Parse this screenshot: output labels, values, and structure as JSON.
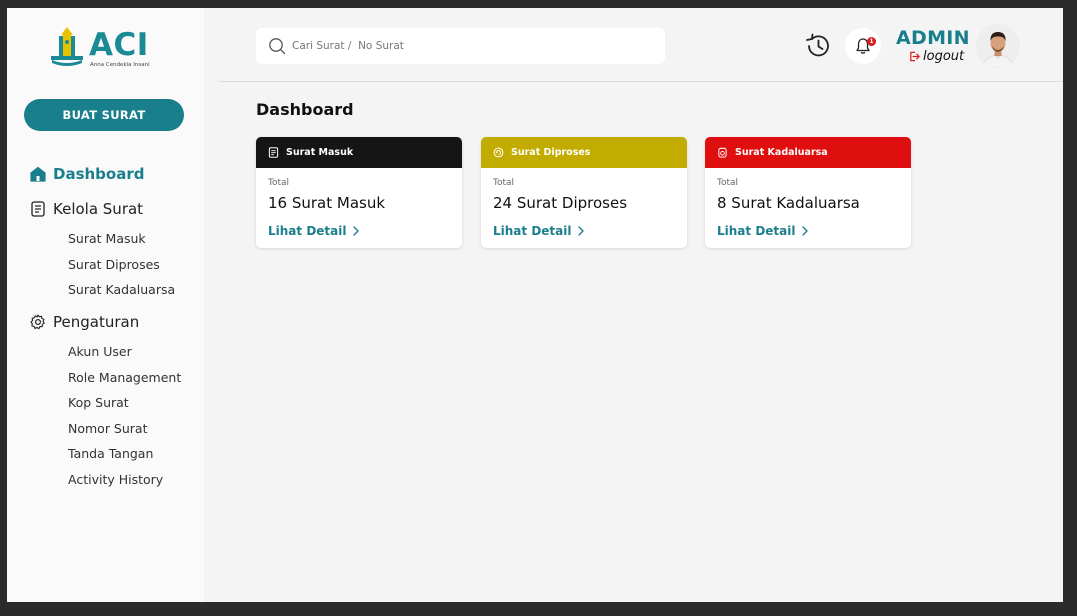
{
  "brand": {
    "name": "ACI",
    "tagline": "Anna Cendekia Insani"
  },
  "sidebar": {
    "create_button": "BUAT SURAT",
    "dashboard": {
      "label": "Dashboard",
      "icon": "home-icon"
    },
    "kelola": {
      "label": "Kelola Surat",
      "icon": "document-icon",
      "items": [
        "Surat Masuk",
        "Surat Diproses",
        "Surat Kadaluarsa"
      ]
    },
    "pengaturan": {
      "label": "Pengaturan",
      "icon": "gear-icon",
      "items": [
        "Akun User",
        "Role Management",
        "Kop Surat",
        "Nomor Surat",
        "Tanda Tangan",
        "Activity History"
      ]
    }
  },
  "header": {
    "search_placeholder": "Cari Surat /  No Surat",
    "notification_count": "1",
    "user_name": "ADMIN",
    "logout_label": "logout"
  },
  "main": {
    "title": "Dashboard",
    "cards": [
      {
        "title": "Surat Masuk",
        "total_label": "Total",
        "value": "16 Surat Masuk",
        "link": "Lihat Detail",
        "color": "#151515",
        "icon": "inbox-icon"
      },
      {
        "title": "Surat Diproses",
        "total_label": "Total",
        "value": "24 Surat Diproses",
        "link": "Lihat Detail",
        "color": "#c2ac00",
        "icon": "process-icon"
      },
      {
        "title": "Surat Kadaluarsa",
        "total_label": "Total",
        "value": "8 Surat Kadaluarsa",
        "link": "Lihat Detail",
        "color": "#e00f0f",
        "icon": "expired-icon"
      }
    ]
  },
  "colors": {
    "accent": "#1a7f8c",
    "notification": "#d81b1b"
  }
}
